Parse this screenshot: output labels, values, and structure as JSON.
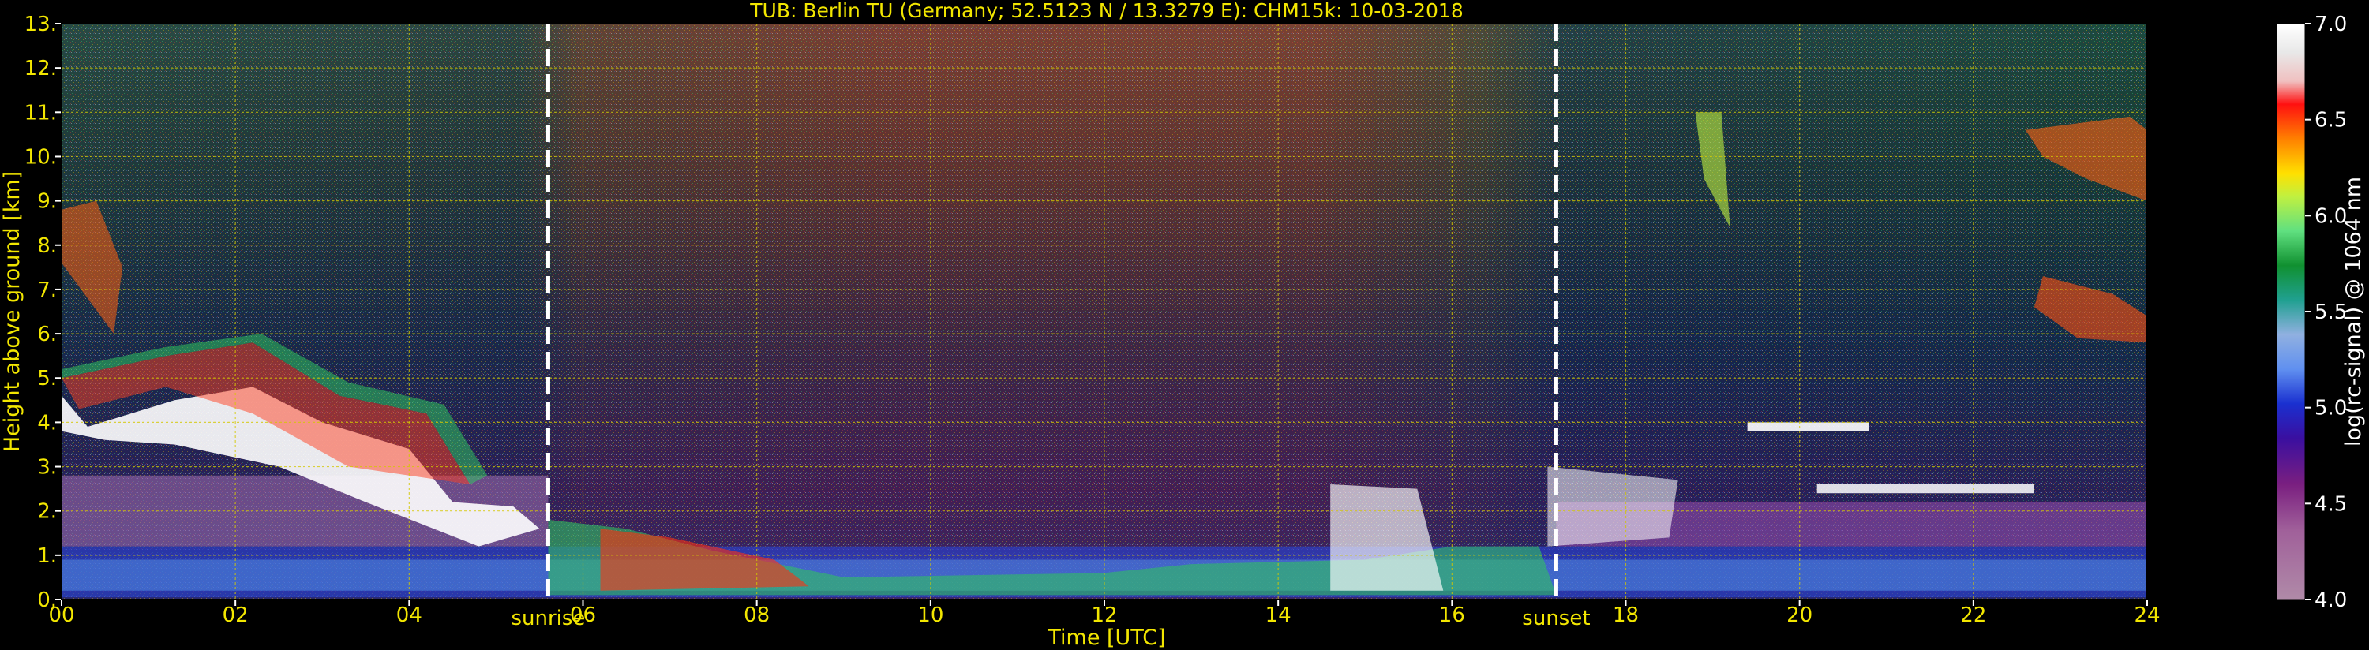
{
  "chart_data": {
    "type": "heatmap",
    "title": "TUB: Berlin TU (Germany; 52.5123 N / 13.3279 E):    CHM15k: 10-03-2018",
    "xlabel": "Time [UTC]",
    "ylabel": "Height above ground [km]",
    "xlim": [
      0,
      24
    ],
    "ylim": [
      0,
      13
    ],
    "x_ticks": [
      "00",
      "02",
      "04",
      "06",
      "08",
      "10",
      "12",
      "14",
      "16",
      "18",
      "20",
      "22",
      "24"
    ],
    "y_ticks": [
      "0.",
      "1.",
      "2.",
      "3.",
      "4.",
      "5.",
      "6.",
      "7.",
      "8.",
      "9.",
      "10.",
      "11.",
      "12.",
      "13."
    ],
    "grid": true,
    "markers": [
      {
        "label": "sunrise",
        "x": 5.6
      },
      {
        "label": "sunset",
        "x": 17.2
      }
    ],
    "colorbar": {
      "label": "log(rc-signal) @ 1064 nm",
      "range": [
        4.0,
        7.0
      ],
      "ticks": [
        "4.0",
        "4.5",
        "5.0",
        "5.5",
        "6.0",
        "6.5",
        "7.0"
      ]
    },
    "colors": {
      "text": "#f2e600",
      "grid": "#d4c800",
      "background": "#000000"
    }
  }
}
